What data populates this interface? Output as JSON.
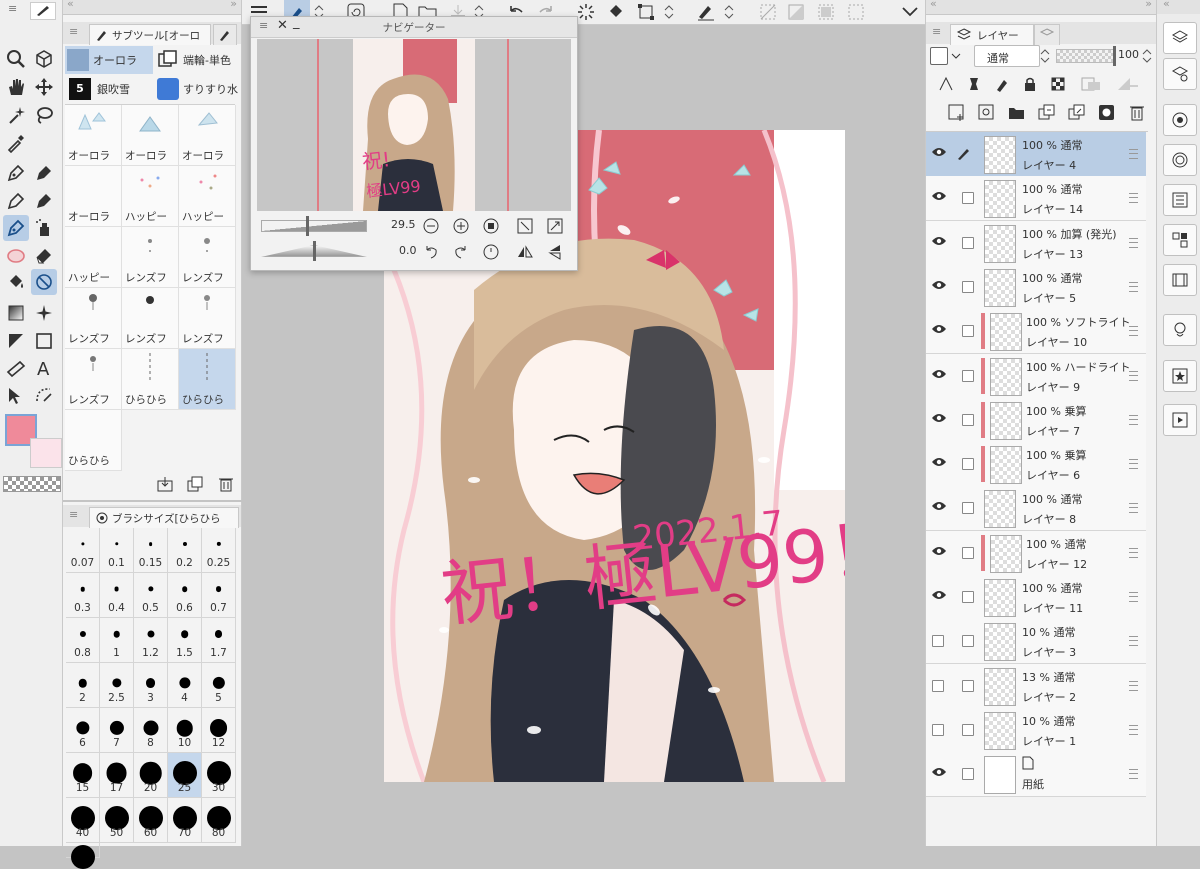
{
  "subtool": {
    "tab_title": "サブツール[オーロ",
    "groups": [
      "オーロラ",
      "端輪-単色",
      "銀吹雪",
      "すりすり水"
    ],
    "brushes": [
      "オーロラ",
      "オーロラ",
      "オーロラ",
      "オーロラ",
      "ハッピー",
      "ハッピー",
      "ハッピー",
      "レンズフ",
      "レンズフ",
      "レンズフ",
      "レンズフ",
      "レンズフ",
      "レンズフ",
      "ひらひら",
      "ひらひら",
      "ひらひら"
    ]
  },
  "brushsize": {
    "tab_title": "ブラシサイズ[ひらひら",
    "sizes": [
      "0.07",
      "0.1",
      "0.15",
      "0.2",
      "0.25",
      "0.3",
      "0.4",
      "0.5",
      "0.6",
      "0.7",
      "0.8",
      "1",
      "1.2",
      "1.5",
      "1.7",
      "2",
      "2.5",
      "3",
      "4",
      "5",
      "6",
      "7",
      "8",
      "10",
      "12",
      "15",
      "17",
      "20",
      "25",
      "30",
      "40",
      "50",
      "60",
      "70",
      "80"
    ],
    "selected": "25"
  },
  "navigator": {
    "title": "ナビゲーター",
    "zoom": "29.5",
    "rotation": "0.0"
  },
  "canvas": {
    "text_main": "祝！極LV99！",
    "text_date": "2022.1.7"
  },
  "colors": {
    "main": "#ef8a9a",
    "sub": "#fbe3ea",
    "accent": "#d9627b",
    "pinkbg": "#d86b76",
    "selection": "#b9cde4"
  },
  "layers_panel": {
    "tab_title": "レイヤー",
    "blend_mode": "通常",
    "opacity": "100",
    "layers": [
      {
        "line1": "100 % 通常",
        "name": "レイヤー 4",
        "visible": true,
        "selected": true,
        "redbar": false
      },
      {
        "line1": "100 % 通常",
        "name": "レイヤー 14",
        "visible": true,
        "selected": false,
        "redbar": false
      },
      {
        "line1": "100 % 加算 (発光)",
        "name": "レイヤー 13",
        "visible": true,
        "selected": false,
        "redbar": false
      },
      {
        "line1": "100 % 通常",
        "name": "レイヤー 5",
        "visible": true,
        "selected": false,
        "redbar": false
      },
      {
        "line1": "100 % ソフトライト",
        "name": "レイヤー 10",
        "visible": true,
        "selected": false,
        "redbar": true
      },
      {
        "line1": "100 % ハードライト",
        "name": "レイヤー 9",
        "visible": true,
        "selected": false,
        "redbar": true
      },
      {
        "line1": "100 % 乗算",
        "name": "レイヤー 7",
        "visible": true,
        "selected": false,
        "redbar": true
      },
      {
        "line1": "100 % 乗算",
        "name": "レイヤー 6",
        "visible": true,
        "selected": false,
        "redbar": true
      },
      {
        "line1": "100 % 通常",
        "name": "レイヤー 8",
        "visible": true,
        "selected": false,
        "redbar": false
      },
      {
        "line1": "100 % 通常",
        "name": "レイヤー 12",
        "visible": true,
        "selected": false,
        "redbar": true
      },
      {
        "line1": "100 % 通常",
        "name": "レイヤー 11",
        "visible": true,
        "selected": false,
        "redbar": false
      },
      {
        "line1": "10 % 通常",
        "name": "レイヤー 3",
        "visible": false,
        "selected": false,
        "redbar": false
      },
      {
        "line1": "13 % 通常",
        "name": "レイヤー 2",
        "visible": false,
        "selected": false,
        "redbar": false
      },
      {
        "line1": "10 % 通常",
        "name": "レイヤー 1",
        "visible": false,
        "selected": false,
        "redbar": false
      },
      {
        "line1": "",
        "name": "用紙",
        "visible": true,
        "selected": false,
        "redbar": false
      }
    ]
  }
}
